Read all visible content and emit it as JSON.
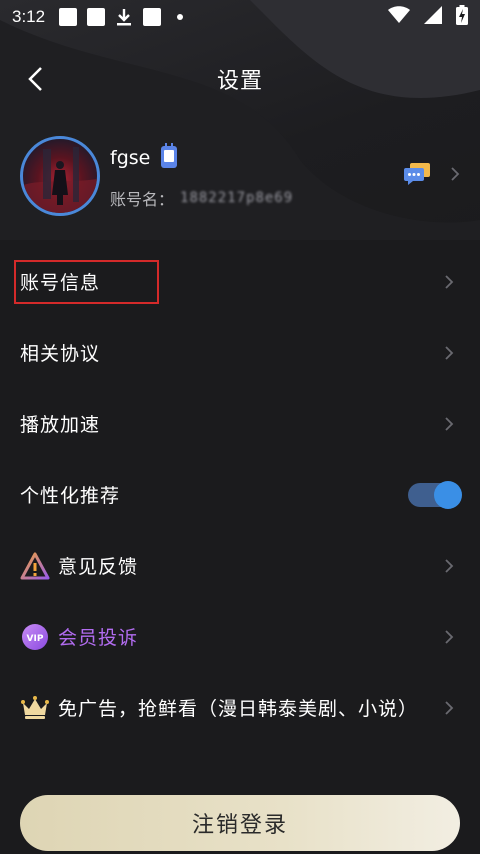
{
  "status_bar": {
    "time": "3:12",
    "icons": [
      "square-notification-icon",
      "square-notification-icon",
      "download-icon",
      "square-notification-icon",
      "dot-icon",
      "wifi-icon",
      "signal-icon",
      "battery-charging-icon"
    ]
  },
  "header": {
    "title": "设置",
    "back_icon": "chevron-left-icon"
  },
  "profile": {
    "username": "fgse",
    "account_label": "账号名：",
    "account_value": "1882217p8e69",
    "badge_icon": "phone-badge-icon",
    "message_icon": "chat-bubble-icon"
  },
  "menu": {
    "items": [
      {
        "label": "账号信息"
      },
      {
        "label": "相关协议"
      },
      {
        "label": "播放加速"
      },
      {
        "label": "个性化推荐",
        "toggle_on": true
      },
      {
        "label": "意见反馈",
        "icon": "warning-triangle-icon"
      },
      {
        "label": "会员投诉",
        "icon": "vip-icon",
        "icon_text": "VIP"
      },
      {
        "label": "免广告，抢鲜看（漫日韩泰美剧、小说）",
        "icon": "crown-icon"
      }
    ]
  },
  "logout": {
    "label": "注销登录"
  },
  "colors": {
    "background": "#1b1b1d",
    "accent_blue": "#3a8fe6",
    "vip_purple": "#b26cf0",
    "highlight_red": "#d42a2a",
    "logout_gold": "#ded5b4"
  }
}
